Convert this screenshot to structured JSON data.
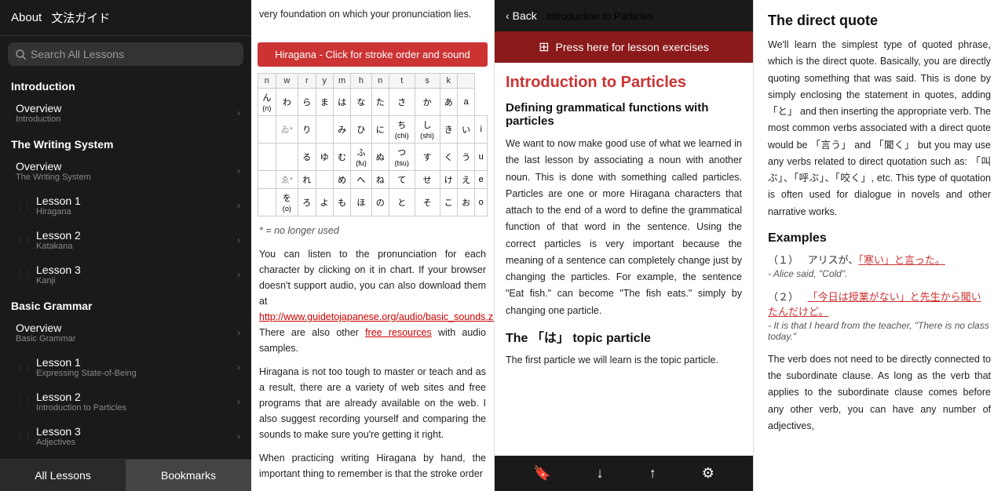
{
  "sidebar": {
    "header": {
      "about_label": "About",
      "title": "文法ガイド"
    },
    "search_placeholder": "Search All Lessons",
    "sections": [
      {
        "id": "introduction",
        "header": "Introduction",
        "items": [
          {
            "label": "Overview",
            "sublabel": "Introduction",
            "has_drag": false
          }
        ]
      },
      {
        "id": "writing_system",
        "header": "The Writing System",
        "items": [
          {
            "label": "Overview",
            "sublabel": "The Writing System",
            "has_drag": false
          },
          {
            "label": "Lesson 1",
            "sublabel": "Hiragana",
            "has_drag": true
          },
          {
            "label": "Lesson 2",
            "sublabel": "Katakana",
            "has_drag": true
          },
          {
            "label": "Lesson 3",
            "sublabel": "Kanji",
            "has_drag": true
          }
        ]
      },
      {
        "id": "basic_grammar",
        "header": "Basic Grammar",
        "items": [
          {
            "label": "Overview",
            "sublabel": "Basic Grammar",
            "has_drag": false
          },
          {
            "label": "Lesson 1",
            "sublabel": "Expressing State-of-Being",
            "has_drag": true
          },
          {
            "label": "Lesson 2",
            "sublabel": "Introduction to Particles",
            "has_drag": true
          },
          {
            "label": "Lesson 3",
            "sublabel": "Adjectives",
            "has_drag": true
          }
        ]
      }
    ],
    "footer": {
      "left_label": "All Lessons",
      "right_label": "Bookmarks"
    }
  },
  "middle": {
    "hiragana_btn": "Hiragana - Click for stroke order and sound",
    "table_headers": [
      "n",
      "w",
      "r",
      "y",
      "m",
      "h",
      "n",
      "t",
      "s",
      "k",
      ""
    ],
    "note": "* = no longer used",
    "paragraphs": [
      "You can listen to the pronunciation for each character by clicking on it in chart. If your browser doesn't support audio, you can also download them at",
      "http://www.guidetojapanese.org/audio/basic_sounds.zip",
      ". There are also other",
      "free resources",
      "with audio samples.",
      "Hiragana is not too tough to master or teach and as a result, there are a variety of web sites and free programs that are already available on the web. I also suggest recording yourself and comparing the sounds to make sure you're getting it right.",
      "When practicing writing Hiragana by hand, the important thing to remember is that the stroke order"
    ],
    "top_text": "very foundation on which your pronunciation lies."
  },
  "lesson": {
    "back_label": "Back",
    "title": "Introduction to Particles",
    "exercises_label": "Press here for lesson exercises",
    "content_title": "Introduction to Particles",
    "content_subtitle": "Defining grammatical functions with particles",
    "content_body": "We want to now make good use of what we learned in the last lesson by associating a noun with another noun. This is done with something called particles. Particles are one or more Hiragana characters that attach to the end of a word to define the grammatical function of that word in the sentence. Using the correct particles is very important because the meaning of a sentence can completely change just by changing the particles. For example, the sentence \"Eat fish.\" can become \"The fish eats.\" simply by changing one particle.",
    "topic_particle_title": "The 「は」 topic particle",
    "topic_particle_body": "The first particle we will learn is the topic particle.",
    "footer_icons": {
      "bookmark": "🔖",
      "down": "↓",
      "up": "↑",
      "settings": "⚙"
    }
  },
  "right": {
    "title": "The direct quote",
    "body1": "We'll learn the simplest type of quoted phrase, which is the direct quote. Basically, you are directly quoting something that was said. This is done by simply enclosing the statement in quotes, adding 「と」 and then inserting the appropriate verb. The most common verbs associated with a direct quote would be 「言う」 and 「聞く」 but you may use any verbs related to direct quotation such as: 「叫ぶ」、「呼ぶ」、「咬く」, etc. This type of quotation is often used for dialogue in novels and other narrative works.",
    "examples_title": "Examples",
    "examples": [
      {
        "num": "（１）",
        "jp_plain": "アリスが、",
        "jp_link": "「寒い」と言った。",
        "en": "- Alice said, \"Cold\"."
      },
      {
        "num": "（２）",
        "jp_link": "「今日は授業がない」と先生から聞いたんだけど。",
        "jp_plain": "",
        "en": "- It is that I heard from the teacher, \"There is no class today.\""
      }
    ],
    "body2": "The verb does not need to be directly connected to the subordinate clause. As long as the verb that applies to the subordinate clause comes before any other verb, you can have any number of adjectives,"
  }
}
